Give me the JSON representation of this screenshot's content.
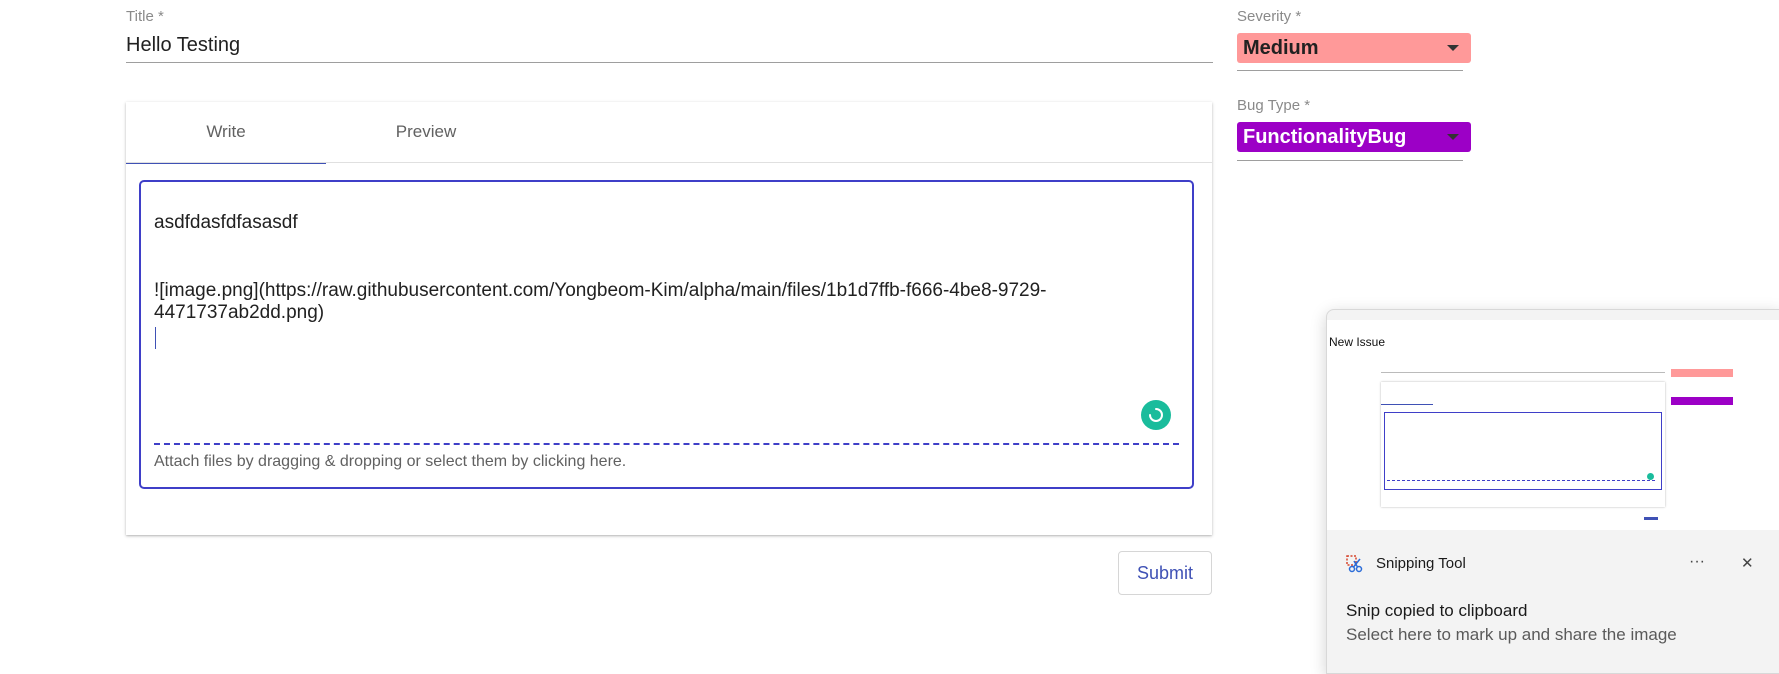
{
  "form": {
    "title_label": "Title *",
    "title_value": "Hello Testing",
    "severity_label": "Severity *",
    "severity_value": "Medium",
    "bugtype_label": "Bug Type *",
    "bugtype_value": "FunctionalityBug",
    "submit_label": "Submit"
  },
  "editor": {
    "tabs": [
      {
        "label": "Write"
      },
      {
        "label": "Preview"
      }
    ],
    "active_tab": "Write",
    "lines": [
      "asdfdasfdfasasdf",
      "![image.png](https://raw.githubusercontent.com/Yongbeom-Kim/alpha/main/files/1b1d7ffb-f666-4be8-9729-",
      "4471737ab2dd.png)"
    ],
    "attach_hint": "Attach files by dragging & dropping or select them by clicking here."
  },
  "toast": {
    "thumbnail_title": "New Issue",
    "app_name": "Snipping Tool",
    "headline": "Snip copied to clipboard",
    "body": "Select here to mark up and share the image",
    "more_icon": "ellipsis-icon",
    "close_icon": "close-icon"
  },
  "colors": {
    "accent": "#3f51b5",
    "severity_medium": "#ff9999",
    "bugtype_functionality": "#9c00c6",
    "spinner": "#1abc9c"
  }
}
